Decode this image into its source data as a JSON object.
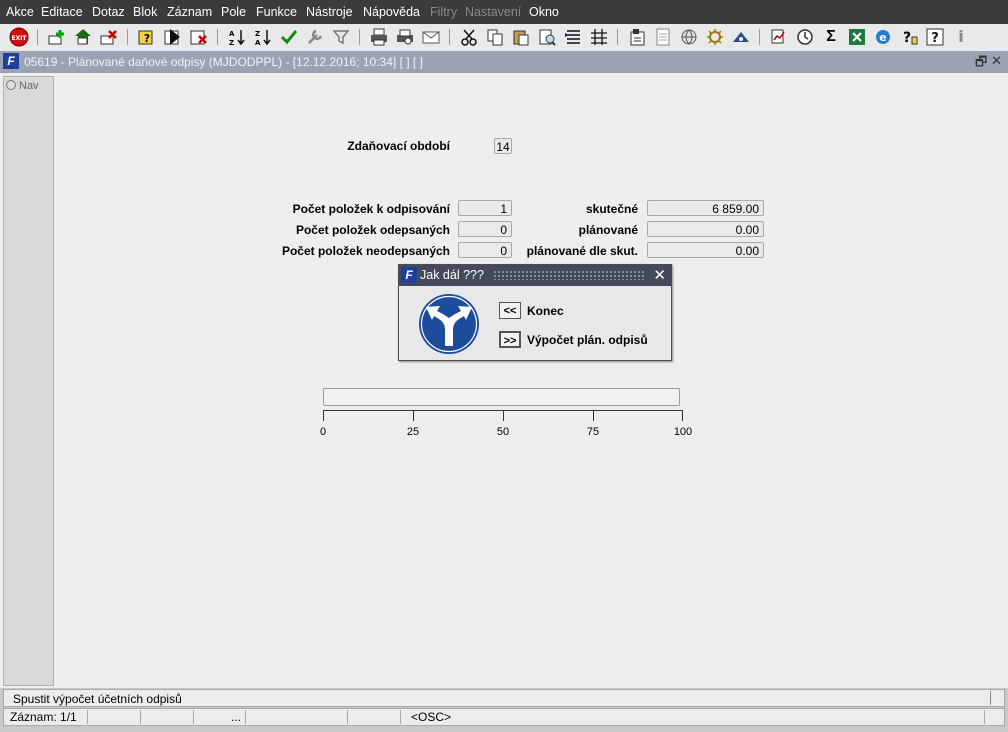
{
  "menu": [
    "Akce",
    "Editace",
    "Dotaz",
    "Blok",
    "Záznam",
    "Pole",
    "Funkce",
    "Nástroje",
    "Nápověda",
    "Filtry",
    "Nastavení",
    "Okno"
  ],
  "menu_disabled": [
    "Filtry",
    "Nastavení"
  ],
  "toolbar": {
    "exit_label": "EXIT",
    "icons": [
      "exit-icon",
      "insert-record-icon",
      "save-record-icon",
      "delete-record-icon",
      "query-icon",
      "run-query-icon",
      "cancel-query-icon",
      "sort-asc-icon",
      "sort-desc-icon",
      "confirm-icon",
      "tools-icon",
      "filter-icon",
      "print-icon",
      "print-preview-icon",
      "mail-icon",
      "cut-icon",
      "copy-icon",
      "paste-icon",
      "find-icon",
      "list-icon",
      "grid-icon",
      "calculator-icon",
      "document-icon",
      "globe-icon",
      "settings-wheel-icon",
      "eye-icon",
      "report-icon",
      "clock-icon",
      "sigma-icon",
      "excel-icon",
      "ie-icon",
      "help-context-icon",
      "help-icon",
      "info-icon"
    ]
  },
  "window": {
    "title": "05619 - Plánované daňové odpisy (MJDODPPL) - [12.12.2016; 10:34]  [ ]  [ ]",
    "icon_letter": "F"
  },
  "nav": {
    "label": "Nav"
  },
  "form": {
    "period_label": "Zdaňovací období",
    "period_value": "14",
    "count_to_depreciate_label": "Počet položek k odpisování",
    "count_to_depreciate_value": "1",
    "count_depreciated_label": "Počet položek odepsaných",
    "count_depreciated_value": "0",
    "count_not_depreciated_label": "Počet položek neodepsaných",
    "count_not_depreciated_value": "0",
    "actual_label": "skutečné",
    "actual_value": "6 859.00",
    "planned_label": "plánované",
    "planned_value": "0.00",
    "planned_actual_label": "plánované dle skut.",
    "planned_actual_value": "0.00"
  },
  "dialog": {
    "title": "Jak dál ???",
    "close_glyph": "✕",
    "btn_back": "<<",
    "btn_back_label": "Konec",
    "btn_next": ">>",
    "btn_next_label": "Výpočet plán. odpisů"
  },
  "progress": {
    "value": 0,
    "ticks": [
      "0",
      "25",
      "50",
      "75",
      "100"
    ]
  },
  "status": {
    "message": "Spustit výpočet účetních odpisů",
    "record": "Záznam: 1/1",
    "ellipsis": "...",
    "mode": "<OSC>"
  }
}
